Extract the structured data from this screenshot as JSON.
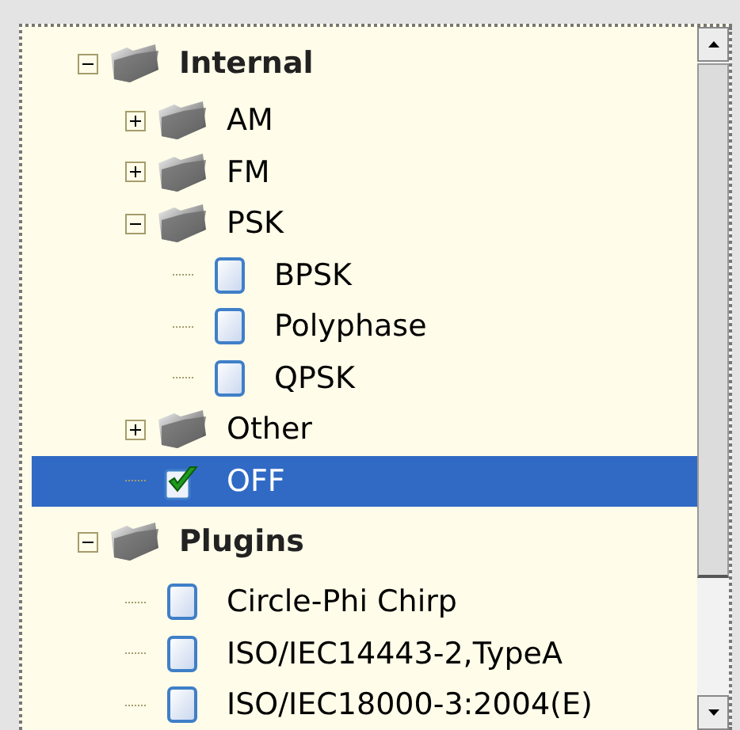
{
  "tree": [
    {
      "label": "Internal",
      "kind": "folder",
      "expanded": true,
      "selected": false,
      "children": [
        {
          "label": "AM",
          "kind": "folder",
          "expanded": false,
          "selected": false
        },
        {
          "label": "FM",
          "kind": "folder",
          "expanded": false,
          "selected": false
        },
        {
          "label": "PSK",
          "kind": "folder",
          "expanded": true,
          "selected": false,
          "children": [
            {
              "label": "BPSK",
              "kind": "item",
              "checked": false,
              "selected": false
            },
            {
              "label": "Polyphase",
              "kind": "item",
              "checked": false,
              "selected": false
            },
            {
              "label": "QPSK",
              "kind": "item",
              "checked": false,
              "selected": false
            }
          ]
        },
        {
          "label": "Other",
          "kind": "folder",
          "expanded": false,
          "selected": false
        },
        {
          "label": "OFF",
          "kind": "item",
          "checked": true,
          "selected": true
        }
      ]
    },
    {
      "label": "Plugins",
      "kind": "folder",
      "expanded": true,
      "selected": false,
      "children": [
        {
          "label": "Circle-Phi Chirp",
          "kind": "item",
          "checked": false,
          "selected": false
        },
        {
          "label": "ISO/IEC14443-2,TypeA",
          "kind": "item",
          "checked": false,
          "selected": false
        },
        {
          "label": "ISO/IEC18000-3:2004(E)",
          "kind": "item",
          "checked": false,
          "selected": false
        }
      ]
    }
  ]
}
